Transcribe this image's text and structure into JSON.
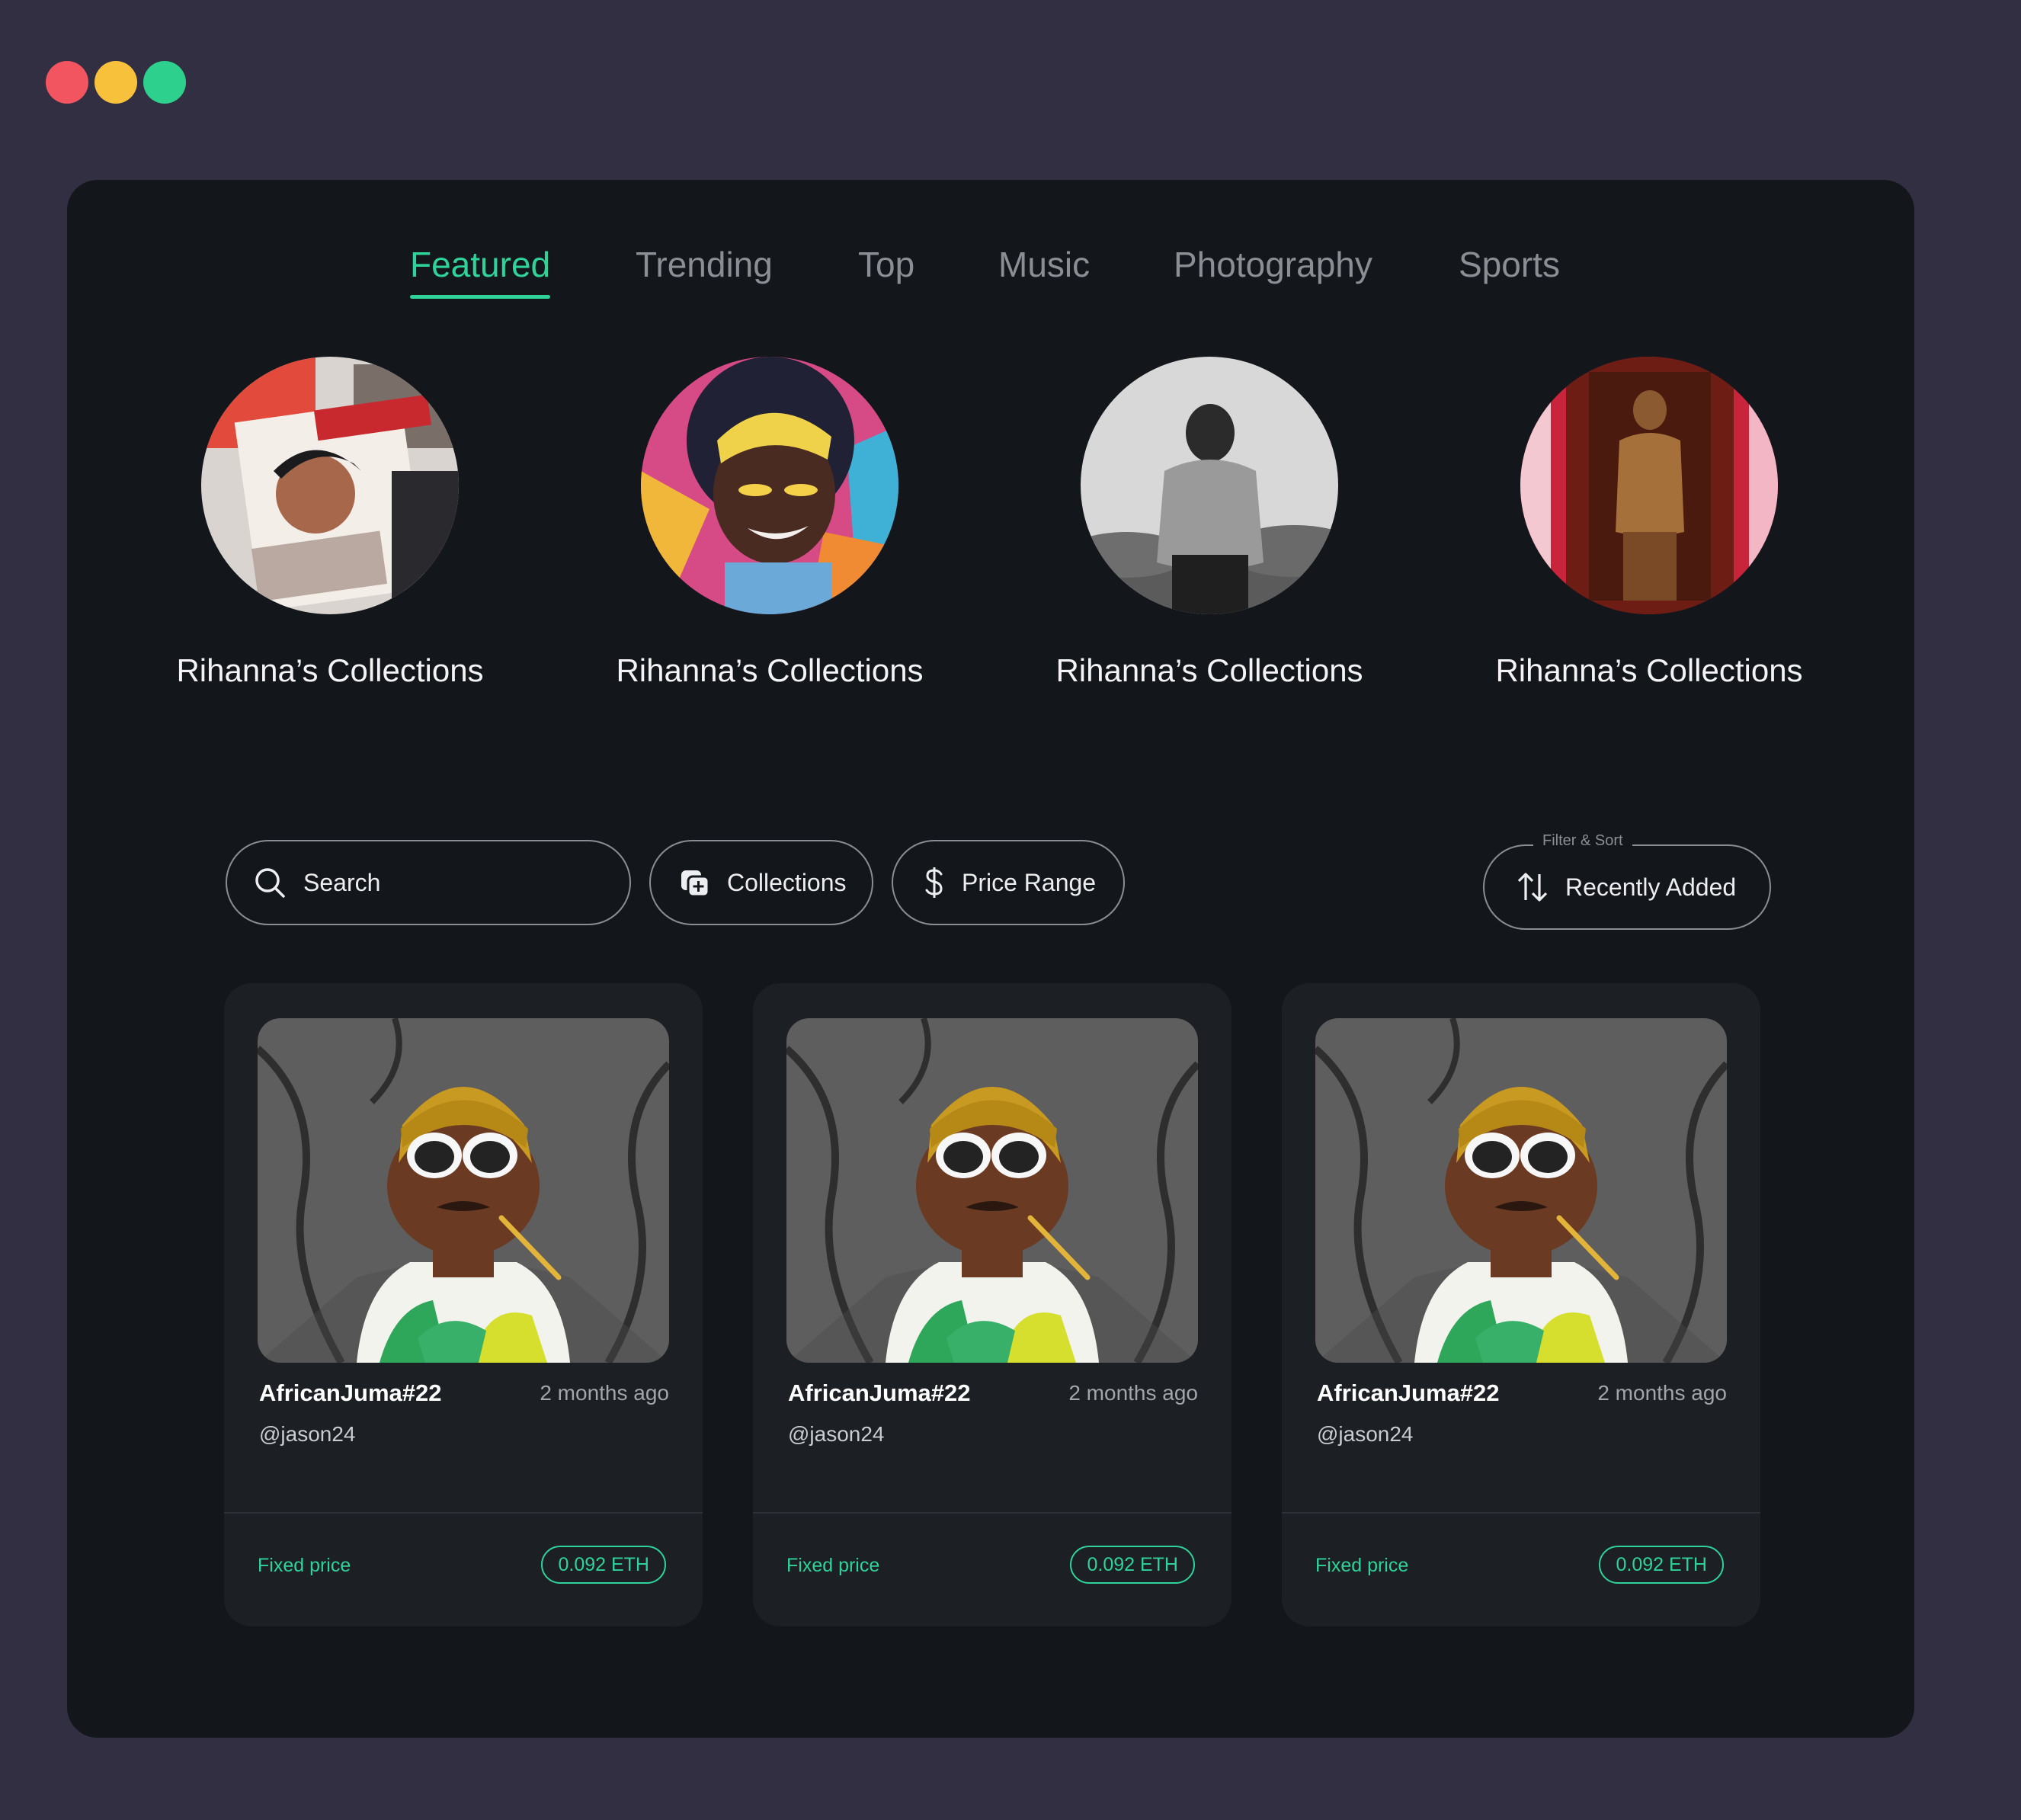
{
  "window_controls": [
    "close",
    "minimize",
    "maximize"
  ],
  "tabs": [
    {
      "label": "Featured",
      "active": true
    },
    {
      "label": "Trending",
      "active": false
    },
    {
      "label": "Top",
      "active": false
    },
    {
      "label": "Music",
      "active": false
    },
    {
      "label": "Photography",
      "active": false
    },
    {
      "label": "Sports",
      "active": false
    }
  ],
  "collections": [
    {
      "name": "Rihanna’s Collections"
    },
    {
      "name": "Rihanna’s Collections"
    },
    {
      "name": "Rihanna’s Collections"
    },
    {
      "name": "Rihanna’s Collections"
    }
  ],
  "filters": {
    "search_placeholder": "Search",
    "collections_label": "Collections",
    "price_range_label": "Price Range",
    "sort_legend": "Filter & Sort",
    "sort_value": "Recently Added"
  },
  "cards": [
    {
      "title": "AfricanJuma#22",
      "time": "2 months ago",
      "handle": "@jason24",
      "price_type": "Fixed price",
      "price": "0.092 ETH"
    },
    {
      "title": "AfricanJuma#22",
      "time": "2 months ago",
      "handle": "@jason24",
      "price_type": "Fixed price",
      "price": "0.092 ETH"
    },
    {
      "title": "AfricanJuma#22",
      "time": "2 months ago",
      "handle": "@jason24",
      "price_type": "Fixed price",
      "price": "0.092 ETH"
    }
  ],
  "colors": {
    "accent": "#2fd39a",
    "background": "#312f41",
    "panel": "#13161a",
    "card": "#1c1f24"
  }
}
